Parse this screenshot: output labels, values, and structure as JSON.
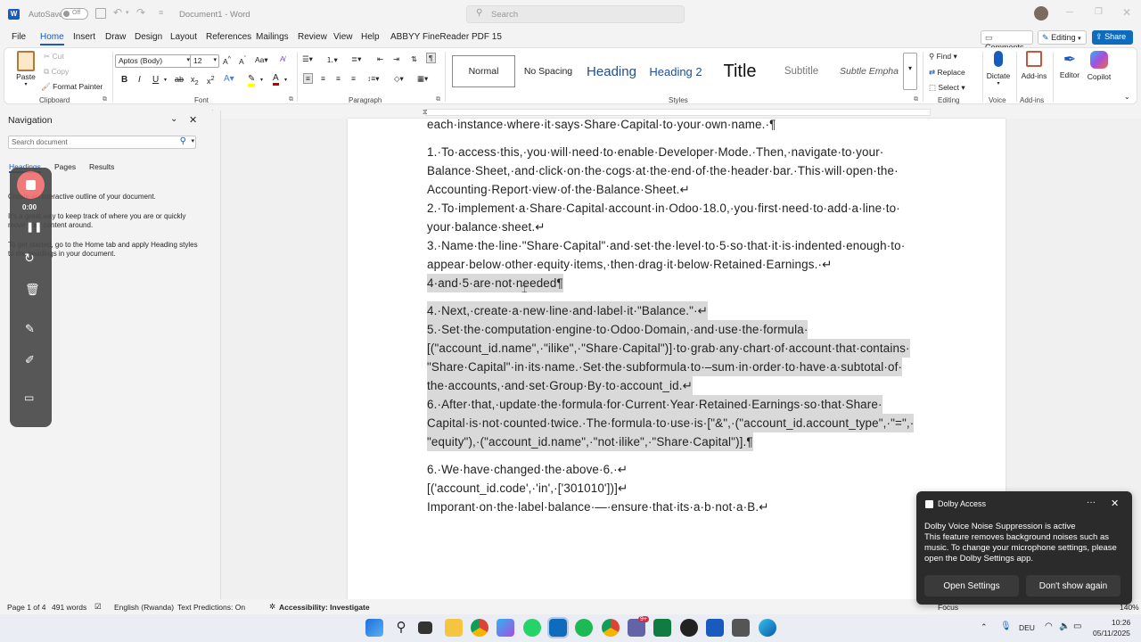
{
  "titlebar": {
    "autosave_label": "AutoSave",
    "autosave_state": "Off",
    "doc_title": "Document1 - Word",
    "search_placeholder": "Search"
  },
  "tabs": [
    "File",
    "Home",
    "Insert",
    "Draw",
    "Design",
    "Layout",
    "References",
    "Mailings",
    "Review",
    "View",
    "Help",
    "ABBYY FineReader PDF 15"
  ],
  "active_tab": "Home",
  "top_right": {
    "comments": "Comments",
    "editing": "Editing",
    "share": "Share"
  },
  "ribbon": {
    "clipboard": {
      "paste": "Paste",
      "cut": "Cut",
      "copy": "Copy",
      "format_painter": "Format Painter",
      "label": "Clipboard"
    },
    "font": {
      "name": "Aptos (Body)",
      "size": "12",
      "label": "Font"
    },
    "paragraph": {
      "label": "Paragraph"
    },
    "styles": {
      "items": [
        "Normal",
        "No Spacing",
        "Heading",
        "Heading 2",
        "Title",
        "Subtitle",
        "Subtle Empha"
      ],
      "label": "Styles"
    },
    "editing": {
      "find": "Find",
      "replace": "Replace",
      "select": "Select",
      "label": "Editing"
    },
    "voice": {
      "dictate": "Dictate",
      "label": "Voice"
    },
    "addins": {
      "addins": "Add-ins",
      "label": "Add-ins"
    },
    "editor": "Editor",
    "copilot": "Copilot"
  },
  "navigation": {
    "title": "Navigation",
    "search_placeholder": "Search document",
    "tabs": [
      "Headings",
      "Pages",
      "Results"
    ],
    "text1": "Create an interactive outline of your document.",
    "text2": "It's a great way to keep track of where you are or quickly move your content around.",
    "text3": "To get started, go to the Home tab and apply Heading styles to the headings in your document."
  },
  "recorder": {
    "time": "0:00"
  },
  "document": {
    "lines": [
      "each·instance·where·it·says·Share·Capital·to·your·own·name.·¶",
      "1.·To·access·this,·you·will·need·to·enable·Developer·Mode.·Then,·navigate·to·your·",
      "Balance·Sheet,·and·click·on·the·cogs·at·the·end·of·the·header·bar.·This·will·open·the·",
      "Accounting·Report·view·of·the·Balance·Sheet.↵",
      "2.·To·implement·a·Share·Capital·account·in·Odoo·18.0,·you·first·need·to·add·a·line·to·",
      "your·balance·sheet.↵",
      "3.·Name·the·line·\"Share·Capital\"·and·set·the·level·to·5·so·that·it·is·indented·enough·to·",
      "appear·below·other·equity·items,·then·drag·it·below·Retained·Earnings.·↵",
      "4·and·5·are·not·needed¶",
      "4.·Next,·create·a·new·line·and·label·it·\"Balance.\"·↵",
      "5.·Set·the·computation·engine·to·Odoo·Domain,·and·use·the·formula·",
      "[(\"account_id.name\",·\"ilike\",·\"Share·Capital\")]·to·grab·any·chart·of·account·that·contains·",
      "\"Share·Capital\"·in·its·name.·Set·the·subformula·to·–sum·in·order·to·have·a·subtotal·of·",
      "the·accounts,·and·set·Group·By·to·account_id.↵",
      "6.·After·that,·update·the·formula·for·Current·Year·Retained·Earnings·so·that·Share·",
      "Capital·is·not·counted·twice.·The·formula·to·use·is·[\"&\",·(\"account_id.account_type\",·\"=\",·",
      "\"equity\"),·(\"account_id.name\",·\"not·ilike\",·\"Share·Capital\")].¶",
      "6.·We·have·changed·the·above·6.·↵",
      "[('account_id.code',·'in',·['301010'])]↵",
      "Imporant·on·the·label·balance·—·ensure·that·its·a·b·not·a·B.↵"
    ]
  },
  "status": {
    "page": "Page 1 of 4",
    "words": "491 words",
    "language": "English (Rwanda)",
    "predictions": "Text Predictions: On",
    "accessibility": "Accessibility: Investigate",
    "focus": "Focus",
    "zoom": "140%"
  },
  "dolby": {
    "app": "Dolby Access",
    "title": "Dolby Voice Noise Suppression is active",
    "body": "This feature removes background noises such as music. To change your microphone settings, please open the Dolby Settings app.",
    "open": "Open Settings",
    "dismiss": "Don't show again"
  },
  "taskbar": {
    "lang": "DEU",
    "time": "10:26",
    "date": "05/11/2025",
    "badge": "9+"
  },
  "colors": {
    "accent": "#185abd",
    "share": "#0f6cbd",
    "selection": "#d9d9d9"
  }
}
